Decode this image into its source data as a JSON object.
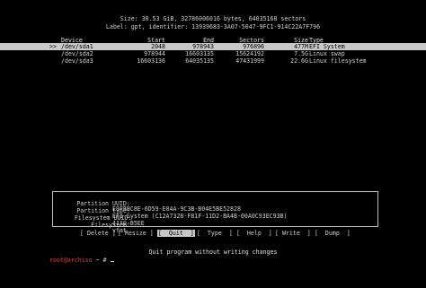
{
  "disk": {
    "size_line": "Size: 30.53 GiB, 32786006016 bytes, 64035168 sectors",
    "label_line": "Label: gpt, identifier: 13939683-3A07-5047-9FC1-914C22A7F796"
  },
  "columns": {
    "device": "Device",
    "start": "Start",
    "end": "End",
    "sectors": "Sectors",
    "size": "Size",
    "type": "Type"
  },
  "partitions": [
    {
      "marker": ">>",
      "device": "/dev/sda1",
      "start": "2048",
      "end": "978943",
      "sectors": "976896",
      "size": "477M",
      "type": "EFI System"
    },
    {
      "marker": "",
      "device": "/dev/sda2",
      "start": "978944",
      "end": "16603135",
      "sectors": "15624192",
      "size": "7.5G",
      "type": "Linux swap"
    },
    {
      "marker": "",
      "device": "/dev/sda3",
      "start": "16603136",
      "end": "64035135",
      "sectors": "47431999",
      "size": "22.6G",
      "type": "Linux filesystem"
    }
  ],
  "info": [
    {
      "key": "Partition UUID:",
      "value": "E9FBBC8E-6D59-E04A-9C3B-B04E5BE52828"
    },
    {
      "key": "Partition type:",
      "value": "EFI System (C12A7328-F81F-11D2-BA4B-00A0C93EC93B)"
    },
    {
      "key": "Filesystem UUID:",
      "value": "41A0-B5EE"
    },
    {
      "key": "Filesystem:",
      "value": "vfat"
    }
  ],
  "menu": [
    "[ Delete ]",
    "[ Resize ]",
    "[  Quit  ]",
    "[  Type  ]",
    "[  Help  ]",
    "[ Write  ]",
    "[  Dump  ]"
  ],
  "status": "Quit program without writing changes",
  "prompt": {
    "user": "root@archiso",
    "rest": " ~ # "
  }
}
